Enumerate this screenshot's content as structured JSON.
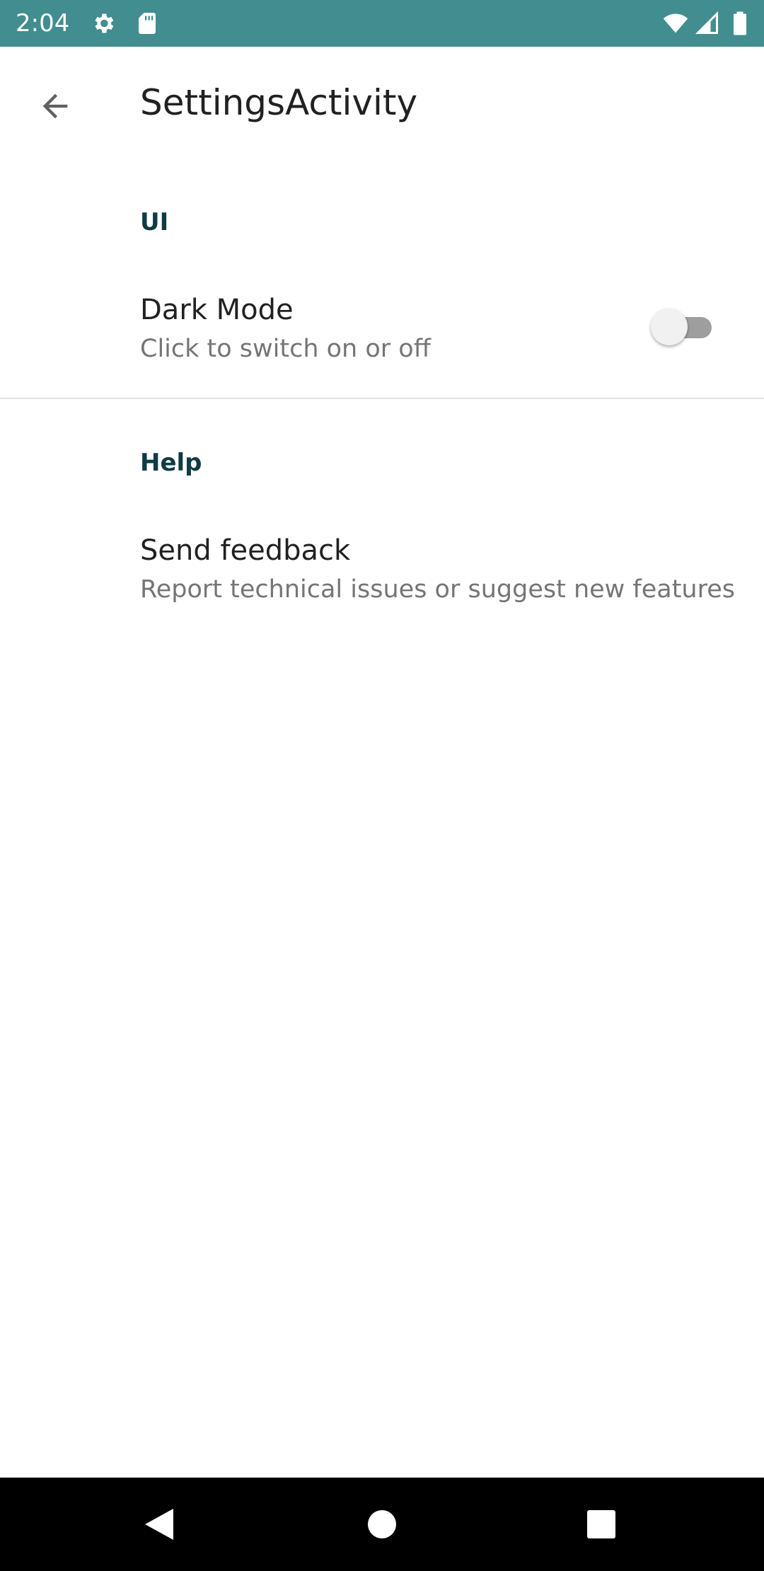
{
  "status_bar": {
    "time": "2:04",
    "icons": [
      "gear-icon",
      "sd-card-icon",
      "wifi-icon",
      "signal-icon",
      "battery-icon"
    ],
    "background_color": "#418d8f"
  },
  "app_bar": {
    "title": "SettingsActivity",
    "back_icon": "arrow-back-icon"
  },
  "sections": [
    {
      "header": "UI",
      "items": [
        {
          "title": "Dark Mode",
          "summary": "Click to switch on or off",
          "switch_on": false
        }
      ]
    },
    {
      "header": "Help",
      "items": [
        {
          "title": "Send feedback",
          "summary": "Report technical issues or suggest new features"
        }
      ]
    }
  ],
  "nav_bar": {
    "icons": [
      "back-triangle-icon",
      "home-circle-icon",
      "recents-square-icon"
    ]
  },
  "colors": {
    "accent_header": "#0f3b45",
    "title_text": "#212121",
    "summary_text": "#757575"
  }
}
